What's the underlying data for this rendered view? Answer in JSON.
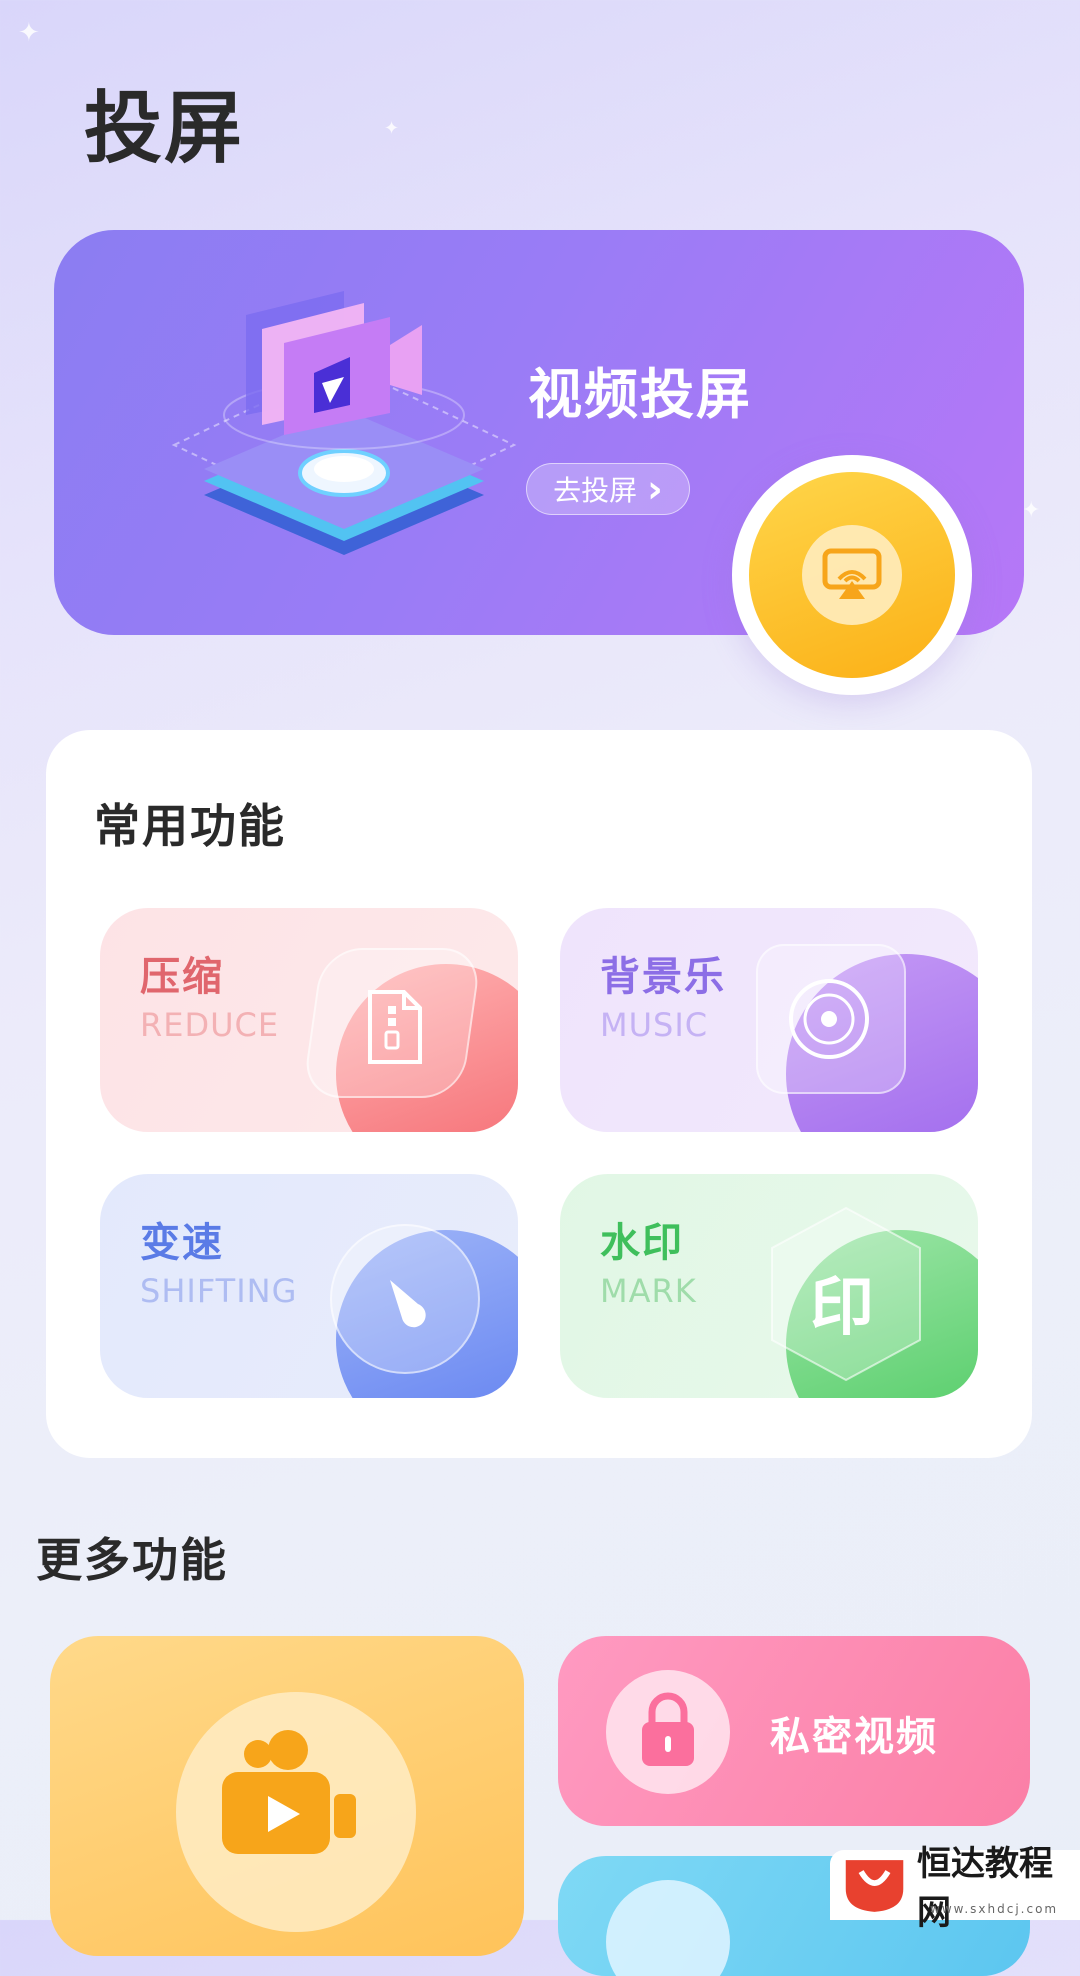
{
  "page": {
    "title": "投屏"
  },
  "banner": {
    "title": "视频投屏",
    "button_label": "去投屏",
    "button_chevron": "›"
  },
  "common": {
    "title": "常用功能",
    "items": [
      {
        "name": "压缩",
        "en": "REDUCE",
        "icon": "zip-file-icon",
        "color": "#e0666d"
      },
      {
        "name": "背景乐",
        "en": "MUSIC",
        "icon": "disc-icon",
        "color": "#8c6ee6"
      },
      {
        "name": "变速",
        "en": "SHIFTING",
        "icon": "speed-gauge-icon",
        "color": "#5a7be6"
      },
      {
        "name": "水印",
        "en": "MARK",
        "icon": "seal-icon",
        "color": "#3fbf5c"
      }
    ]
  },
  "more": {
    "title": "更多功能",
    "private_video_label": "私密视频",
    "seal_glyph": "印"
  },
  "watermark": {
    "name": "恒达教程网",
    "url": "www.sxhdcj.com"
  }
}
